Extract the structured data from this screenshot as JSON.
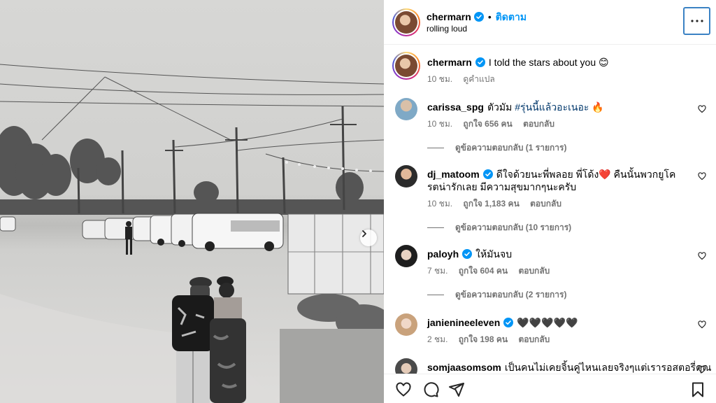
{
  "post": {
    "username": "chermarn",
    "follow_label": "ติดตาม",
    "dot": "•",
    "location": "rolling loud",
    "caption": "I told the stars about you 😊",
    "caption_time": "10 ชม.",
    "translate_label": "ดูคำแปล"
  },
  "comments": [
    {
      "username": "carissa_spg",
      "text_before": "ตัวมัม ",
      "hashtag": "#รุ่นนี้แล้วอะเนอะ",
      "text_after": " 🔥",
      "time": "10 ชม.",
      "likes": "ถูกใจ 656 คน",
      "reply": "ตอบกลับ",
      "view_replies": "ดูข้อความตอบกลับ (1 รายการ)"
    },
    {
      "username": "dj_matoom",
      "text": "ดีใจด้วยนะพี่พลอย พี่โด้ง❤️ คืนนั้นพวกยูโครตน่ารักเลย มีความสุขมากๆนะครับ",
      "time": "10 ชม.",
      "likes": "ถูกใจ 1,183 คน",
      "reply": "ตอบกลับ",
      "view_replies": "ดูข้อความตอบกลับ (10 รายการ)"
    },
    {
      "username": "paloyh",
      "text": "ให้มันจบ",
      "time": "7 ชม.",
      "likes": "ถูกใจ 604 คน",
      "reply": "ตอบกลับ",
      "view_replies": "ดูข้อความตอบกลับ (2 รายการ)"
    },
    {
      "username": "janienineeleven",
      "text": "🖤🖤🖤🖤🖤",
      "time": "2 ชม.",
      "likes": "ถูกใจ 198 คน",
      "reply": "ตอบกลับ"
    },
    {
      "username": "somjaasomsom",
      "text": "เป็นคนไม่เคยจิ้นคู่ไหนเลยจริงๆแต่เรารอสตอรี่คุณ"
    }
  ],
  "icons": {
    "like": "heart-icon",
    "comment": "comment-icon",
    "share": "paper-plane-icon",
    "save": "bookmark-icon",
    "more": "more-options-icon",
    "next": "chevron-right-icon"
  },
  "colors": {
    "accent": "#0095f6",
    "verified": "#0095f6",
    "secondary_text": "#737373",
    "focus_ring": "#3b82c4"
  }
}
